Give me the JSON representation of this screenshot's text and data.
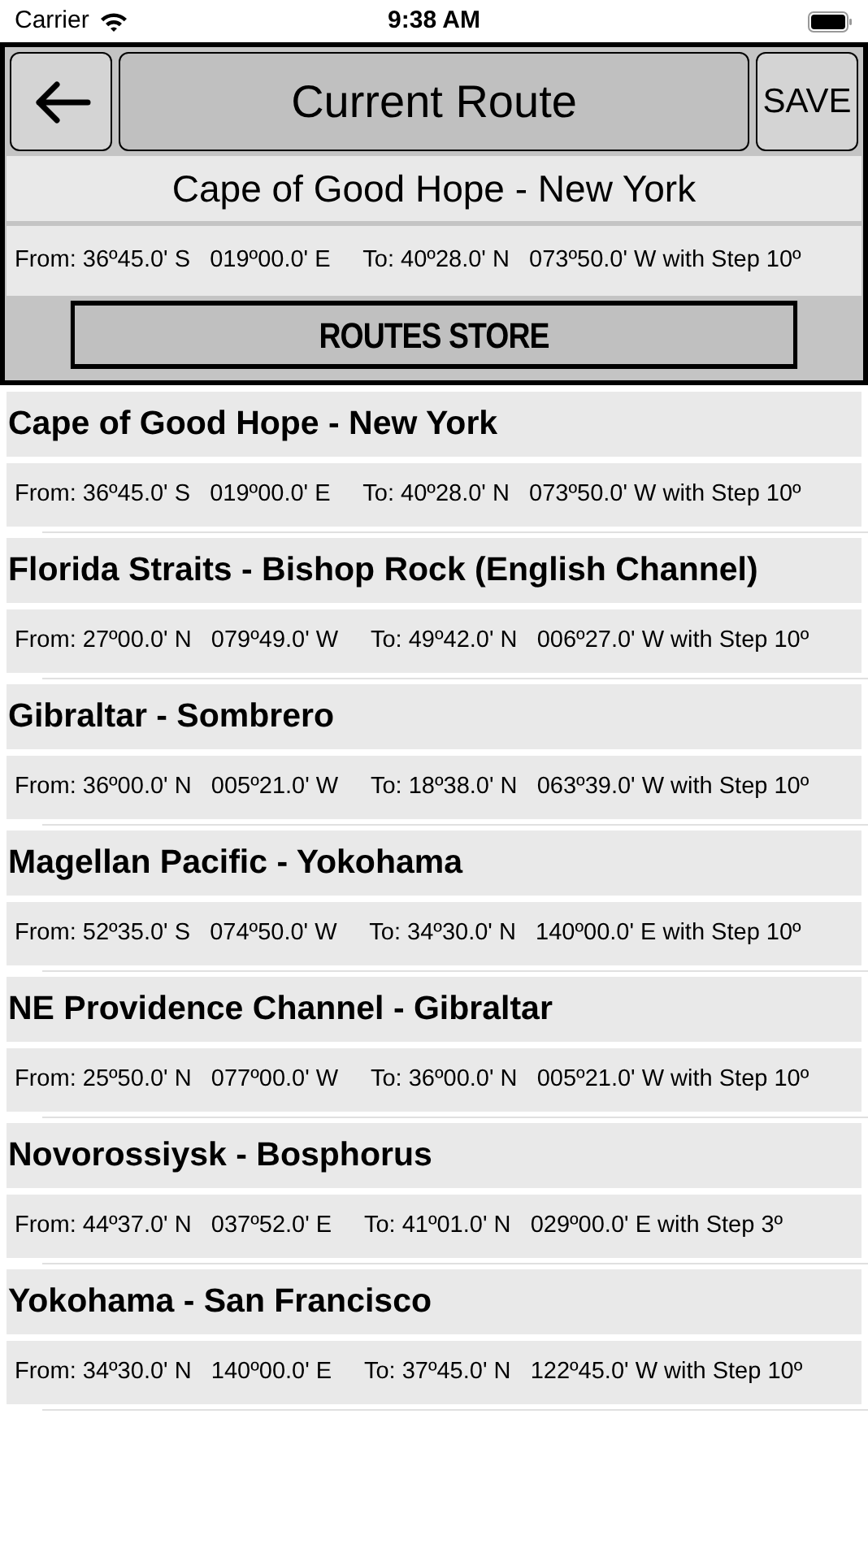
{
  "status_bar": {
    "carrier": "Carrier",
    "time": "9:38 AM"
  },
  "header": {
    "title": "Current Route",
    "save": "SAVE",
    "route_name": "Cape of Good Hope - New York",
    "route_detail": "From: 36º45.0' S   019º00.0' E     To: 40º28.0' N   073º50.0' W with Step 10º",
    "store_button": "ROUTES STORE"
  },
  "routes": [
    {
      "name": "Cape of Good Hope - New York",
      "detail": "From: 36º45.0' S   019º00.0' E     To: 40º28.0' N   073º50.0' W with Step 10º"
    },
    {
      "name": "Florida Straits - Bishop Rock (English Channel)",
      "detail": "From: 27º00.0' N   079º49.0' W     To: 49º42.0' N   006º27.0' W with Step 10º"
    },
    {
      "name": "Gibraltar - Sombrero",
      "detail": "From: 36º00.0' N   005º21.0' W     To: 18º38.0' N   063º39.0' W with Step 10º"
    },
    {
      "name": "Magellan Pacific - Yokohama",
      "detail": "From: 52º35.0' S   074º50.0' W     To: 34º30.0' N   140º00.0' E with Step 10º"
    },
    {
      "name": "NE Providence Channel - Gibraltar",
      "detail": "From: 25º50.0' N   077º00.0' W     To: 36º00.0' N   005º21.0' W with Step 10º"
    },
    {
      "name": "Novorossiysk - Bosphorus",
      "detail": "From: 44º37.0' N   037º52.0' E     To: 41º01.0' N   029º00.0' E with Step 3º"
    },
    {
      "name": "Yokohama - San Francisco",
      "detail": "From: 34º30.0' N   140º00.0' E     To: 37º45.0' N   122º45.0' W with Step 10º"
    }
  ]
}
